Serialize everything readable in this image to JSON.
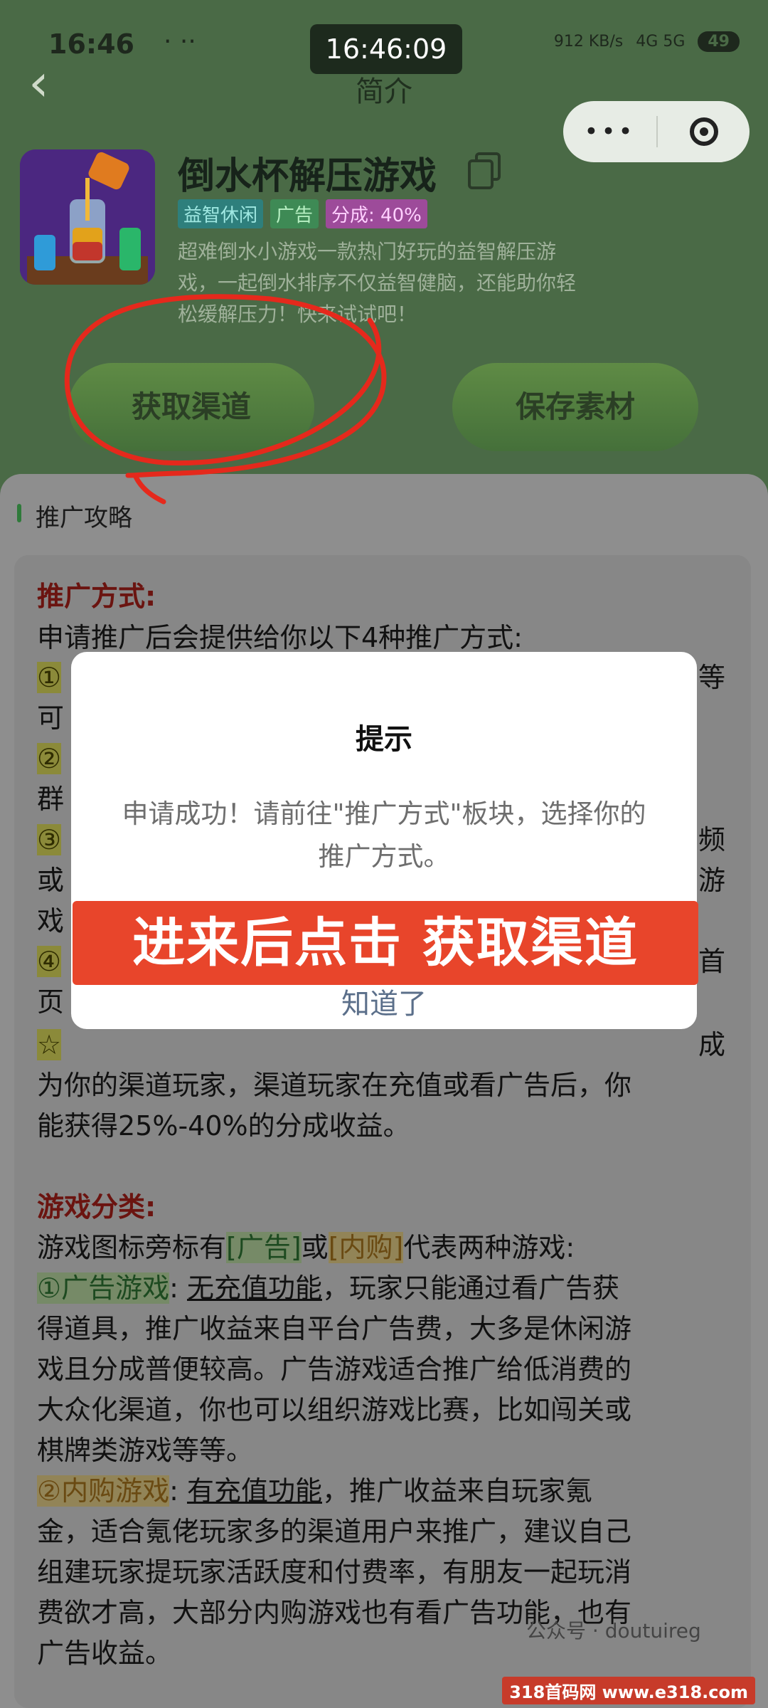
{
  "status": {
    "time": "16:46",
    "dots": "· ··",
    "net": "912 KB/s",
    "signal": "4G 5G",
    "battery": "49"
  },
  "clock_overlay": "16:46:09",
  "header": {
    "title": "简介",
    "back": "‹"
  },
  "capsule": {
    "more": "•••"
  },
  "app": {
    "name": "倒水杯解压游戏",
    "tags": [
      "益智休闲",
      "广告",
      "分成: 40%"
    ],
    "description": "超难倒水小游戏一款热门好玩的益智解压游戏，一起倒水排序不仅益智健脑，还能助你轻松缓解压力！快来试试吧！"
  },
  "buttons": {
    "get_channel": "获取渠道",
    "save_material": "保存素材"
  },
  "section": {
    "title": "推广攻略"
  },
  "content": {
    "promo_heading": "推广方式:",
    "promo_intro": "申请推广后会提供给你以下4种推广方式:",
    "partial_lines": [
      "①",
      "等",
      "可",
      "②",
      "群",
      "③",
      "频",
      "或",
      "游",
      "戏",
      "④",
      "首",
      "页"
    ],
    "star_line_end": "成",
    "promo_rule_1": "为你的渠道玩家，渠道玩家在充值或看广告后，你",
    "promo_rule_2": "能获得25%-40%的分成收益。",
    "cat_heading": "游戏分类:",
    "cat_intro_a": "游戏图标旁标有",
    "cat_intro_b": "[广告]",
    "cat_intro_c": "或",
    "cat_intro_d": "[内购]",
    "cat_intro_e": "代表两种游戏:",
    "ad_label": "①广告游戏",
    "ad_colon": ":",
    "ad_underline": "无充值功能",
    "ad_text_1": "，玩家只能通过看广告获",
    "ad_text_2": "得道具，推广收益来自平台广告费，大多是休闲游",
    "ad_text_3": "戏且分成普便较高。广告游戏适合推广给低消费的",
    "ad_text_4": "大众化渠道，你也可以组织游戏比赛，比如闯关或",
    "ad_text_5": "棋牌类游戏等等。",
    "iap_label": "②内购游戏",
    "iap_colon": ":",
    "iap_underline": "有充值功能",
    "iap_text_1": "，推广收益来自玩家氪",
    "iap_text_2": "金，适合氪佬玩家多的渠道用户来推广，建议自己",
    "iap_text_3": "组建玩家提玩家活跃度和付费率，有朋友一起玩消",
    "iap_text_4": "费欲才高，大部分内购游戏也有看广告功能，也有",
    "iap_text_5": "广告收益。"
  },
  "dialog": {
    "title": "提示",
    "message": "申请成功！请前往\"推广方式\"板块，选择你的推广方式。",
    "ok": "知道了"
  },
  "annotation_banner": "进来后点击 获取渠道",
  "watermark": "公众号 · doutuireg",
  "site_mark": "318首码网 www.e318.com"
}
